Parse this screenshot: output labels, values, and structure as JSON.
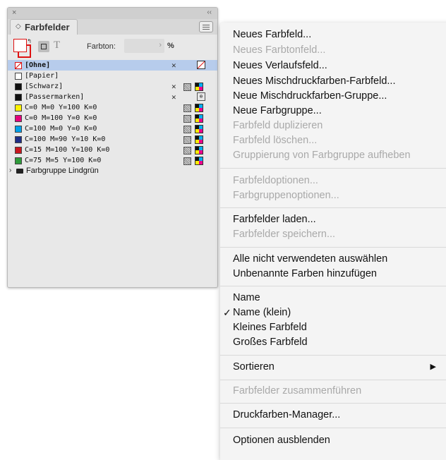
{
  "panel": {
    "close_glyph": "×",
    "collapse_glyph": "‹‹",
    "tab_glyph": "◇",
    "title": "Farbfelder",
    "tint_label": "Farbton:",
    "tint_value": "",
    "tint_unit": "%",
    "swatches": [
      {
        "name": "[Ohne]",
        "color": "#ffffff",
        "selected": true
      },
      {
        "name": "[Papier]",
        "color": "#ffffff"
      },
      {
        "name": "[Schwarz]",
        "color": "#111111"
      },
      {
        "name": "[Passermarken]",
        "color": "#111111"
      },
      {
        "name": "C=0 M=0 Y=100 K=0",
        "color": "#fff200"
      },
      {
        "name": "C=0 M=100 Y=0 K=0",
        "color": "#e4007c"
      },
      {
        "name": "C=100 M=0 Y=0 K=0",
        "color": "#00a0e9"
      },
      {
        "name": "C=100 M=90 Y=10 K=0",
        "color": "#1f2e86"
      },
      {
        "name": "C=15 M=100 Y=100 K=0",
        "color": "#c8161e"
      },
      {
        "name": "C=75 M=5 Y=100 K=0",
        "color": "#2e9b3a"
      }
    ],
    "group_name": "Farbgruppe Lindgrün"
  },
  "menu": {
    "items": [
      {
        "label": "Neues Farbfeld...",
        "disabled": false
      },
      {
        "label": "Neues Farbtonfeld...",
        "disabled": true
      },
      {
        "label": "Neues Verlaufsfeld...",
        "disabled": false
      },
      {
        "label": "Neues Mischdruckfarben-Farbfeld...",
        "disabled": false
      },
      {
        "label": "Neue Mischdruckfarben-Gruppe...",
        "disabled": false
      },
      {
        "label": "Neue Farbgruppe...",
        "disabled": false
      },
      {
        "label": "Farbfeld duplizieren",
        "disabled": true
      },
      {
        "label": "Farbfeld löschen...",
        "disabled": true
      },
      {
        "label": "Gruppierung von Farbgruppe aufheben",
        "disabled": true
      },
      {
        "label": "Farbfeldoptionen...",
        "disabled": true
      },
      {
        "label": "Farbgruppenoptionen...",
        "disabled": true
      },
      {
        "label": "Farbfelder laden...",
        "disabled": false
      },
      {
        "label": "Farbfelder speichern...",
        "disabled": true
      },
      {
        "label": "Alle nicht verwendeten auswählen",
        "disabled": false
      },
      {
        "label": "Unbenannte Farben hinzufügen",
        "disabled": false
      },
      {
        "label": "Name",
        "disabled": false
      },
      {
        "label": "Name (klein)",
        "disabled": false,
        "checked": true
      },
      {
        "label": "Kleines Farbfeld",
        "disabled": false
      },
      {
        "label": "Großes Farbfeld",
        "disabled": false
      },
      {
        "label": "Sortieren",
        "disabled": false,
        "submenu": true
      },
      {
        "label": "Farbfelder zusammenführen",
        "disabled": true
      },
      {
        "label": "Druckfarben-Manager...",
        "disabled": false
      },
      {
        "label": "Optionen ausblenden",
        "disabled": false
      }
    ],
    "check_glyph": "✓",
    "submenu_glyph": "▶"
  }
}
